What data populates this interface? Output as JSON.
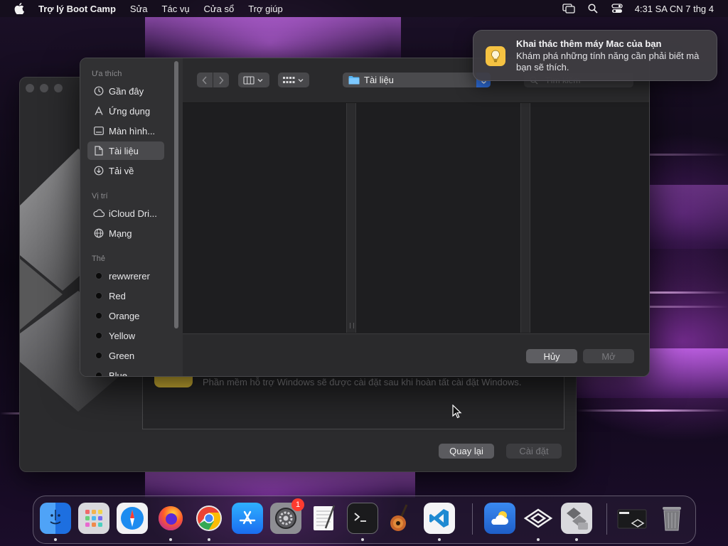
{
  "menubar": {
    "app_name": "Trợ lý Boot Camp",
    "items": [
      "Sửa",
      "Tác vụ",
      "Cửa sổ",
      "Trợ giúp"
    ],
    "clock": "4:31 SA CN 7 thg 4",
    "status_icons": [
      "screen-mirroring-icon",
      "search-icon",
      "control-center-icon"
    ]
  },
  "notification": {
    "title": "Khai thác thêm máy Mac của bạn",
    "body": "Khám phá những tính năng cần phải biết mà bạn sẽ thích.",
    "icon": "lightbulb-icon",
    "accent": "#f5c242"
  },
  "bootcamp": {
    "info_text": "Phần mềm hỗ trợ Windows sẽ được cài đặt sau khi hoàn tất cài đặt Windows.",
    "back_label": "Quay lại",
    "install_label": "Cài đặt"
  },
  "panel": {
    "sidebar": {
      "favorites_header": "Ưa thích",
      "favorites": [
        {
          "label": "Gần đây",
          "icon": "clock-icon"
        },
        {
          "label": "Ứng dụng",
          "icon": "apps-icon"
        },
        {
          "label": "Màn hình...",
          "icon": "desktop-icon"
        },
        {
          "label": "Tài liệu",
          "icon": "document-icon",
          "selected": true
        },
        {
          "label": "Tải về",
          "icon": "download-icon"
        }
      ],
      "locations_header": "Vị trí",
      "locations": [
        {
          "label": "iCloud Dri...",
          "icon": "cloud-icon"
        },
        {
          "label": "Mạng",
          "icon": "globe-icon"
        }
      ],
      "tags_header": "Thẻ",
      "tags": [
        "rewwrerer",
        "Red",
        "Orange",
        "Yellow",
        "Green",
        "Blue"
      ]
    },
    "toolbar": {
      "path_label": "Tài liệu",
      "search_placeholder": "Tìm kiếm"
    },
    "footer": {
      "cancel_label": "Hủy",
      "open_label": "Mở"
    }
  },
  "dock": {
    "apps": [
      "Finder",
      "Launchpad",
      "Safari",
      "Firefox",
      "Chrome",
      "App Store",
      "System Settings",
      "TextEdit",
      "Terminal",
      "GarageBand",
      "Visual Studio Code",
      "Weather",
      "Parallels",
      "Boot Camp Assistant",
      "Downloads",
      "Trash"
    ],
    "system_settings_badge": "1"
  }
}
